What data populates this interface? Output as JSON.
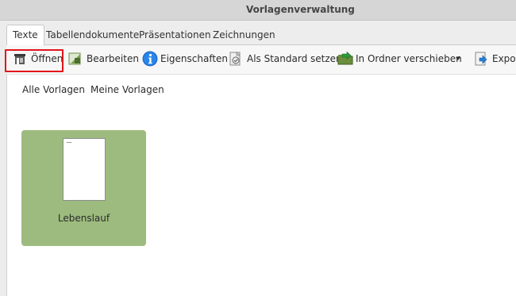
{
  "window": {
    "title": "Vorlagenverwaltung"
  },
  "tabs": [
    {
      "label": "Texte",
      "active": true
    },
    {
      "label": "Tabellendokumente"
    },
    {
      "label": "Präsentationen"
    },
    {
      "label": "Zeichnungen"
    }
  ],
  "toolbar": {
    "open": {
      "label": "Öffnen",
      "icon": "open-icon"
    },
    "edit": {
      "label": "Bearbeiten",
      "icon": "edit-icon"
    },
    "properties": {
      "label": "Eigenschaften",
      "icon": "info-icon"
    },
    "set_default": {
      "label": "Als Standard setzen",
      "icon": "set-default-icon"
    },
    "move": {
      "label": "In Ordner verschieben",
      "icon": "move-to-folder-icon"
    },
    "export": {
      "label": "Expor",
      "icon": "export-icon"
    }
  },
  "filters": {
    "all": "Alle Vorlagen",
    "mine": "Meine Vorlagen"
  },
  "templates": [
    {
      "name": "Lebenslauf",
      "selected": true
    }
  ],
  "colors": {
    "highlight": "#e3141b",
    "selected_card": "#9dbb7e"
  }
}
